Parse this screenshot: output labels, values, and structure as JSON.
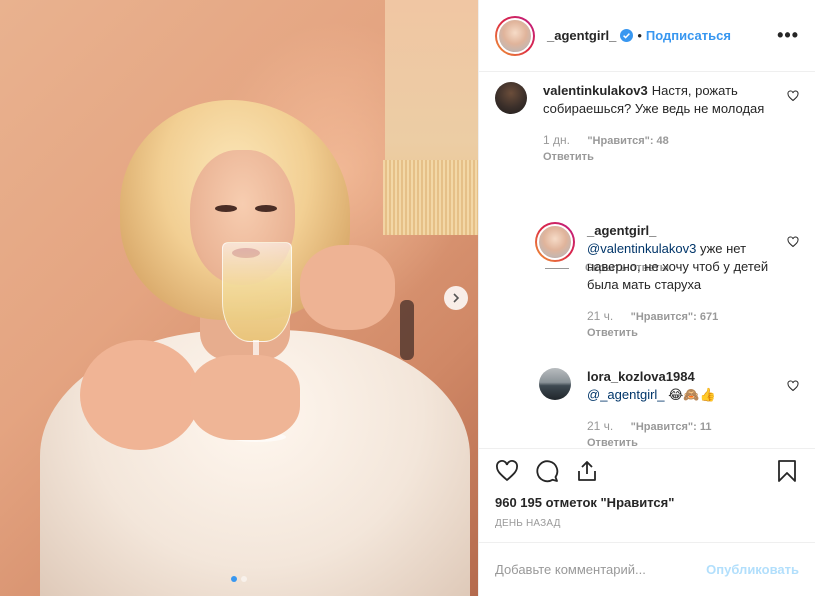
{
  "header": {
    "username": "_agentgirl_",
    "verified_icon": "verified-badge-icon",
    "separator": "•",
    "follow_label": "Подписаться",
    "more_label": "•••"
  },
  "photo": {
    "carousel_total": 2,
    "carousel_active": 1
  },
  "comments": [
    {
      "username": "valentinkulakov3",
      "text": "Настя, рожать собираешься? Уже ведь не молодая",
      "time": "1 дн.",
      "likes": "\"Нравится\": 48",
      "reply": "Ответить"
    }
  ],
  "hide_replies_label": "Скрыть ответы",
  "replies": [
    {
      "username": "_agentgirl_",
      "mention": "@valentinkulakov3",
      "text": " уже нет наверно, не хочу чтоб у детей была мать старуха",
      "time": "21 ч.",
      "likes": "\"Нравится\": 671",
      "reply": "Ответить"
    },
    {
      "username": "lora_kozlova1984",
      "mention": "@_agentgirl_",
      "text": " 😂🙈👍",
      "time": "21 ч.",
      "likes": "\"Нравится\": 11",
      "reply": "Ответить"
    }
  ],
  "footer": {
    "likes_text": "960 195 отметок \"Нравится\"",
    "date_text": "ДЕНЬ НАЗАД",
    "comment_placeholder": "Добавьте комментарий...",
    "publish_label": "Опубликовать"
  },
  "colors": {
    "accent": "#3897f0",
    "publish_disabled": "#b2dffc",
    "muted": "#999999",
    "text": "#262626"
  }
}
